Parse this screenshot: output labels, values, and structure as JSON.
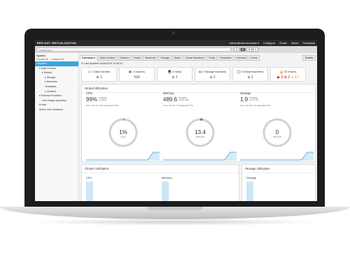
{
  "app": {
    "brand": "RED HAT VIRTUALIZATION"
  },
  "topbar": {
    "links": [
      "admin@internal-authz ▾",
      "Configure",
      "Guide",
      "About",
      "Feedback"
    ]
  },
  "search": {
    "value": "Dashboard",
    "buttons": [
      "x",
      "★",
      "▾",
      "⌕"
    ]
  },
  "sidebar": {
    "title": "System",
    "expand_label": "Expand All",
    "collapse_label": "Collapse All",
    "tree": [
      {
        "label": "▾ System",
        "indent": 0,
        "selected": true
      },
      {
        "label": "▾ Data Centers",
        "indent": 1
      },
      {
        "label": "▾ Default",
        "indent": 2
      },
      {
        "label": "▸ Storage",
        "indent": 3
      },
      {
        "label": "▸ Networks",
        "indent": 3
      },
      {
        "label": "Templates",
        "indent": 3
      },
      {
        "label": "▸ Clusters",
        "indent": 3
      },
      {
        "label": "▾ External Providers",
        "indent": 1
      },
      {
        "label": "ovirt-image-repository",
        "indent": 2
      },
      {
        "label": "Errata",
        "indent": 1
      },
      {
        "label": "Active User Sessions",
        "indent": 1
      }
    ]
  },
  "tabs": [
    "Dashboard",
    "Data Centers",
    "Clusters",
    "Hosts",
    "Networks",
    "Storage",
    "Disks",
    "Virtual Machines",
    "Pools",
    "Templates",
    "Volumes",
    "Users"
  ],
  "events_button": "Events",
  "last_updated": "⟳ Last Updated 04/08/2016 14:36:22",
  "cards": [
    {
      "title": "☐ 1 Data Centers",
      "value": "⊕ 1"
    },
    {
      "title": "▦ 1 Clusters",
      "value": "N/A"
    },
    {
      "title": "🖥 2 Hosts",
      "value": "⊕ 2"
    },
    {
      "title": "▤ 2 Storage Domains",
      "value": "⊕ 2"
    },
    {
      "title": "🖵 2 Virtual Machines",
      "value": "⊕ 2"
    },
    {
      "title": "🔔 22 Events",
      "v1": "▶ 3",
      "v2": "⊗ 2",
      "v3": "⚠ 17"
    }
  ],
  "global_utilization": {
    "title": "Global Utilization",
    "columns": [
      {
        "name": "CPU",
        "percent": "99%",
        "avail_line1": "Available",
        "avail_line2": "of 100%",
        "commit": "Over commit: 11% (allocated 11%)",
        "center_value": "1%",
        "center_label": "Used",
        "used_fraction": 0.01
      },
      {
        "name": "Memory",
        "percent": "489.6",
        "avail_line1": "Available",
        "avail_line2": "of 503 GiB",
        "commit": "Over commit: 7% (allocated 7%)",
        "center_value": "13.4",
        "center_label": "GiB Used",
        "used_fraction": 0.027
      },
      {
        "name": "Storage",
        "percent": "1.9",
        "avail_line1": "Available",
        "avail_line2": "of 1.9 TiB",
        "commit": "Over commit: 0% (allocated 4%)",
        "center_value": "0",
        "center_label": "TiB Used",
        "used_fraction": 0.0
      }
    ]
  },
  "cluster_utilization": {
    "title": "Cluster Utilization",
    "cpu": "CPU",
    "memory": "Memory"
  },
  "storage_utilization": {
    "title": "Storage Utilization",
    "storage": "Storage"
  },
  "colors": {
    "accent": "#39a5dc",
    "topbar": "#2a2a2a",
    "donut_track": "#d1d1d1",
    "memory_used": "#3f9c35"
  }
}
